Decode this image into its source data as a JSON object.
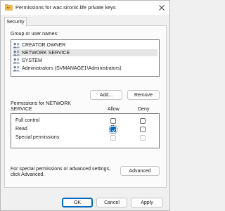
{
  "window": {
    "title": "Permissions for wac.sironic.life private keys"
  },
  "tabs": [
    {
      "label": "Security"
    }
  ],
  "groups": {
    "label": "Group or user names:",
    "items": [
      {
        "label": "CREATOR OWNER"
      },
      {
        "label": "NETWORK SERVICE",
        "selected": true
      },
      {
        "label": "SYSTEM"
      },
      {
        "label": "Administrators (SVMANAGE1\\Administrators)"
      }
    ],
    "add_label": "Add...",
    "remove_label": "Remove"
  },
  "permissions": {
    "label_line1": "Permissions for NETWORK",
    "label_line2": "SERVICE",
    "allow_header": "Allow",
    "deny_header": "Deny",
    "rows": [
      {
        "name": "Full control",
        "allow": false,
        "deny": false
      },
      {
        "name": "Read",
        "allow": true,
        "deny": false
      },
      {
        "name": "Special permissions",
        "allow": false,
        "deny": false
      }
    ]
  },
  "advanced": {
    "note_line1": "For special permissions or advanced settings,",
    "note_line2": "click Advanced.",
    "button_label": "Advanced"
  },
  "footer": {
    "ok_label": "OK",
    "cancel_label": "Cancel",
    "apply_label": "Apply"
  },
  "colors": {
    "accent": "#0067c0",
    "dialog_bg": "#f0f0f0",
    "panel_bg": "#fbfbfb"
  }
}
